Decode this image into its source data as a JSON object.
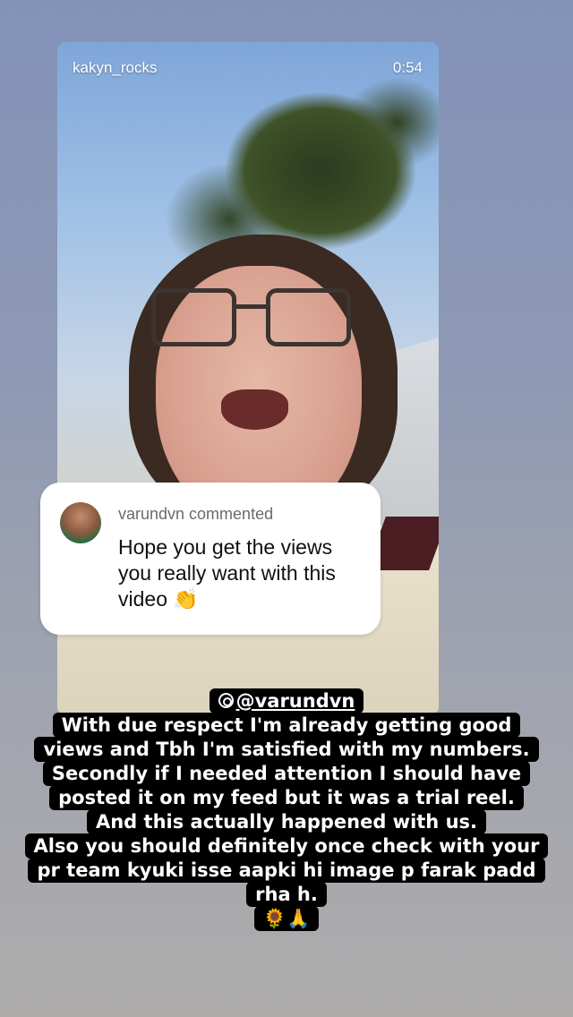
{
  "story": {
    "username": "kakyn_rocks",
    "duration": "0:54"
  },
  "comment": {
    "header": "varundvn commented",
    "body": "Hope you get the views you really want with this video 👏"
  },
  "reply": {
    "mention": "@varundvn",
    "lines": [
      "With due respect I'm already getting good",
      "views and Tbh I'm satisfied with my numbers.",
      "Secondly if I needed attention I should have",
      "posted it on my feed but it was a trial reel.",
      "And this actually happened with us.",
      "Also you should definitely once check with your",
      "pr team kyuki isse aapki hi image p farak padd",
      "rha h.",
      "🌻🙏"
    ]
  }
}
